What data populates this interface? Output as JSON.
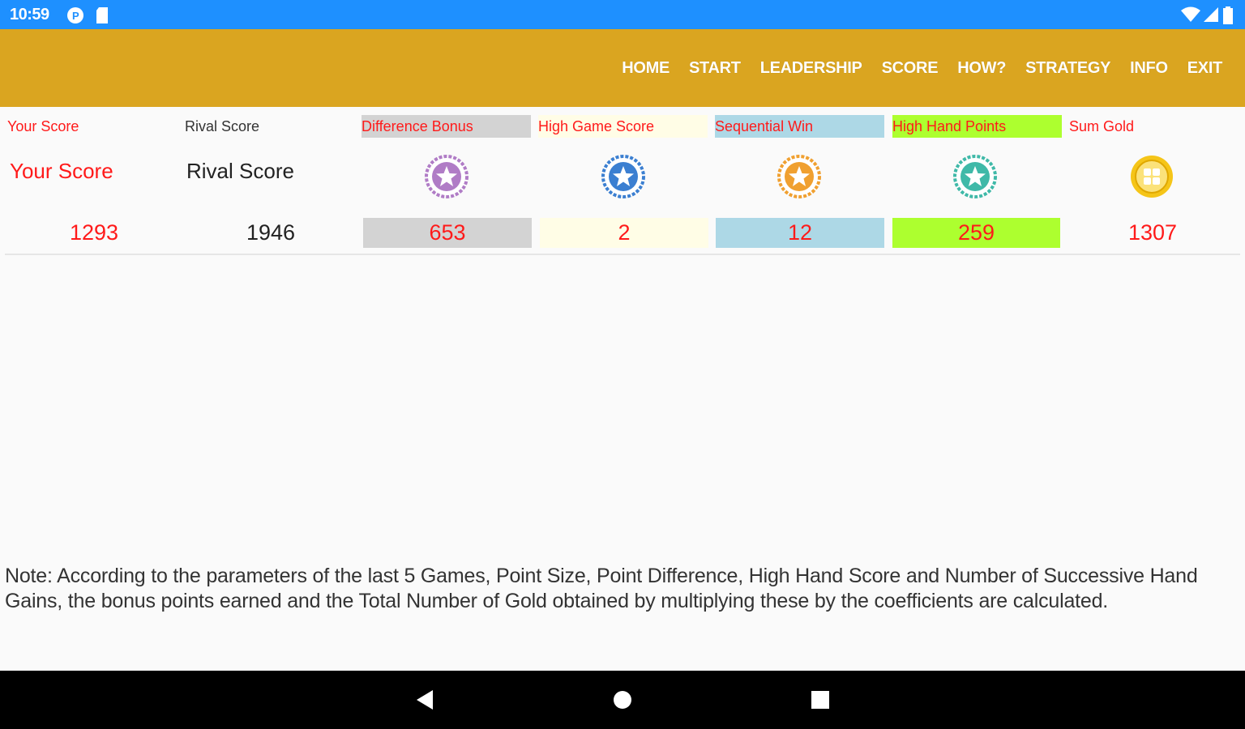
{
  "status": {
    "time": "10:59"
  },
  "nav": {
    "items": [
      "HOME",
      "START",
      "LEADERSHIP",
      "SCORE",
      "HOW?",
      "STRATEGY",
      "INFO",
      "EXIT"
    ]
  },
  "headers": {
    "your_score": "Your Score",
    "rival_score": "Rival Score",
    "difference_bonus": "Difference Bonus",
    "high_game_score": "High Game Score",
    "sequential_win": "Sequential Win",
    "high_hand_points": "High Hand Points",
    "sum_gold": "Sum Gold"
  },
  "labels": {
    "your_score": "Your Score",
    "rival_score": "Rival Score"
  },
  "values": {
    "your_score": "1293",
    "rival_score": "1946",
    "difference_bonus": "653",
    "high_game_score": "2",
    "sequential_win": "12",
    "high_hand_points": "259",
    "sum_gold": "1307"
  },
  "colors": {
    "status_bar": "#1e90ff",
    "app_bar": "#daa520",
    "accent_red": "#ff1a1a",
    "difference_bonus_bg": "#d3d3d3",
    "high_game_score_bg": "#fffde6",
    "sequential_win_bg": "#add8e6",
    "high_hand_points_bg": "#adff2f",
    "badge_purple": "#b07cc6",
    "badge_blue": "#3b7fd1",
    "badge_orange": "#f0a030",
    "badge_teal": "#3fb9a8",
    "badge_gold": "#f5c518"
  },
  "icons": {
    "difference_bonus": "star-badge-purple-icon",
    "high_game_score": "star-badge-blue-icon",
    "sequential_win": "star-badge-orange-icon",
    "high_hand_points": "star-badge-teal-icon",
    "sum_gold": "gold-coin-icon"
  },
  "note": "Note: According to the parameters of the last 5 Games, Point Size, Point Difference, High Hand Score and Number of Successive Hand Gains, the bonus points earned and the Total Number of Gold obtained by multiplying these by the coefficients are calculated."
}
